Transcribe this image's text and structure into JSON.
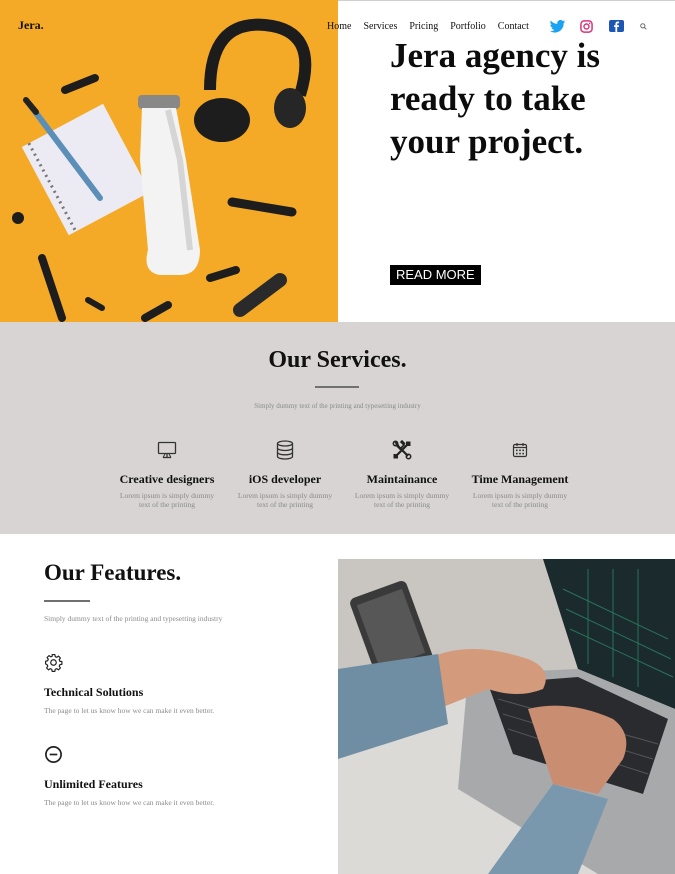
{
  "brand": "Jera.",
  "nav": {
    "items": [
      "Home",
      "Services",
      "Pricing",
      "Portfolio",
      "Contact"
    ],
    "icons": [
      "twitter-icon",
      "instagram-icon",
      "facebook-icon",
      "search-icon"
    ]
  },
  "hero": {
    "title": "Jera agency is ready to take your project.",
    "button": "READ MORE",
    "accent": "#f5a623"
  },
  "services": {
    "title": "Our Services.",
    "subtitle": "Simply dummy text of the printing and typesetting industry",
    "items": [
      {
        "icon": "monitor-icon",
        "title": "Creative designers",
        "desc": "Lorem ipsum is simply dummy text of the printing"
      },
      {
        "icon": "database-icon",
        "title": "iOS developer",
        "desc": "Lorem ipsum is simply dummy text of the printing"
      },
      {
        "icon": "tools-icon",
        "title": "Maintainance",
        "desc": "Lorem ipsum is simply dummy text of the printing"
      },
      {
        "icon": "calendar-icon",
        "title": "Time Management",
        "desc": "Lorem ipsum is simply dummy text of the printing"
      }
    ],
    "background": "#d7d4d3"
  },
  "features": {
    "title": "Our Features.",
    "subtitle": "Simply dummy text of the printing and typesetting industry",
    "items": [
      {
        "icon": "gear-icon",
        "title": "Technical Solutions",
        "desc": "The page to let us know how we can make it even better."
      },
      {
        "icon": "minus-circle-icon",
        "title": "Unlimited Features",
        "desc": "The page to let us know how we can make it even better."
      }
    ]
  }
}
